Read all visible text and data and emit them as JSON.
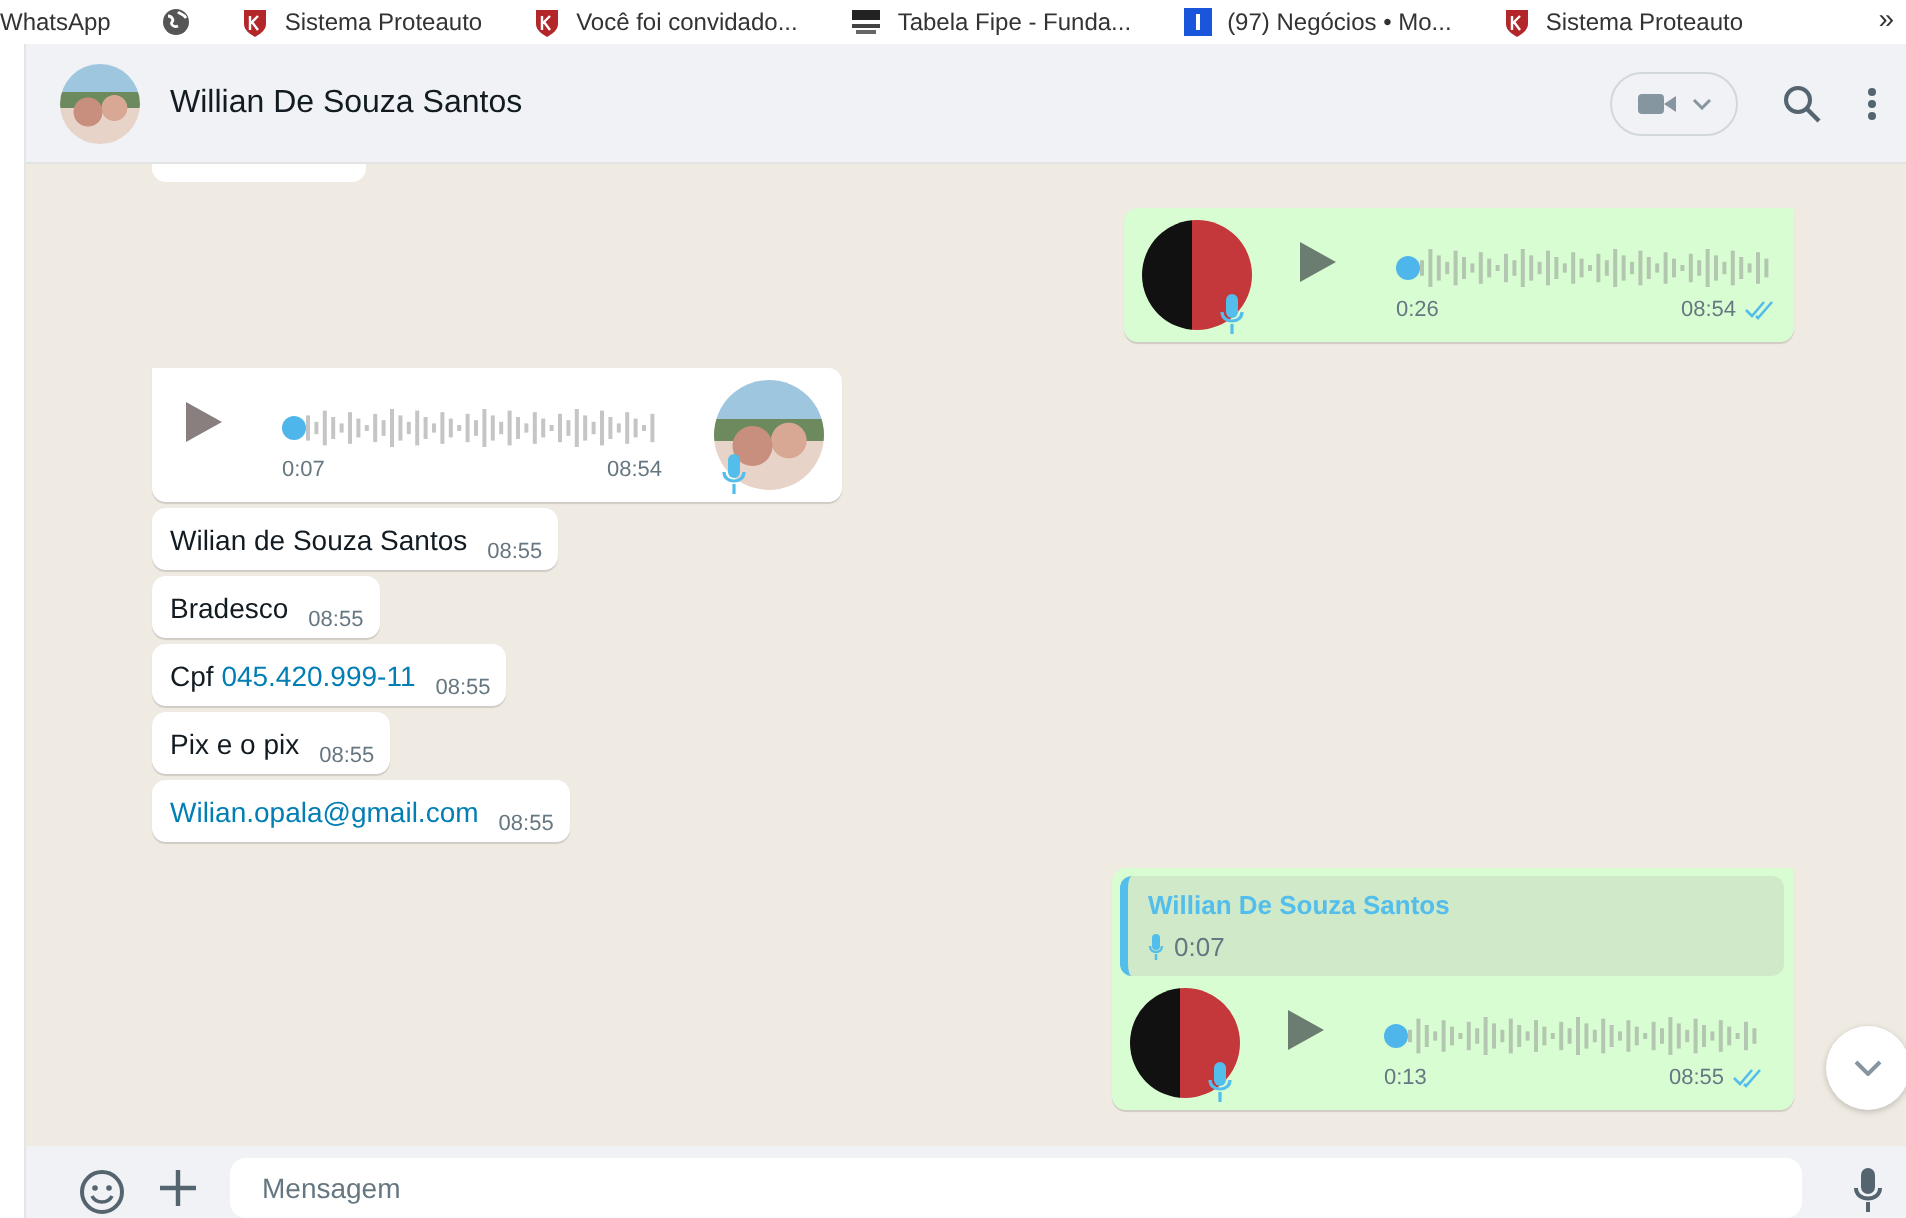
{
  "bookmarks": [
    {
      "kind": "text",
      "label": "WhatsApp"
    },
    {
      "kind": "globe"
    },
    {
      "kind": "shield",
      "label": "Sistema Proteauto"
    },
    {
      "kind": "shield",
      "label": "Você foi convidado..."
    },
    {
      "kind": "fipe",
      "label": "Tabela Fipe - Funda..."
    },
    {
      "kind": "square",
      "label": "(97) Negócios • Mo..."
    },
    {
      "kind": "shield",
      "label": "Sistema Proteauto"
    }
  ],
  "bookmarks_more": "»",
  "header": {
    "name": "Willian De Souza Santos"
  },
  "messages": [
    {
      "kind": "voice",
      "outgoing": true,
      "duration": "0:26",
      "time": "08:54",
      "read": true
    },
    {
      "kind": "voice",
      "outgoing": false,
      "duration": "0:07",
      "time": "08:54"
    },
    {
      "kind": "text",
      "outgoing": false,
      "text": "Wilian de Souza Santos",
      "time": "08:55"
    },
    {
      "kind": "text",
      "outgoing": false,
      "text": "Bradesco",
      "time": "08:55"
    },
    {
      "kind": "text",
      "outgoing": false,
      "text": "Cpf",
      "link": "045.420.999-11",
      "time": "08:55"
    },
    {
      "kind": "text",
      "outgoing": false,
      "text": "Pix e o pix",
      "time": "08:55"
    },
    {
      "kind": "text",
      "outgoing": false,
      "link": "Wilian.opala@gmail.com",
      "time": "08:55"
    },
    {
      "kind": "quoted_voice",
      "outgoing": true,
      "quote_name": "Willian De Souza Santos",
      "quote_duration": "0:07",
      "duration": "0:13",
      "time": "08:55",
      "read": true
    }
  ],
  "composer": {
    "placeholder": "Mensagem"
  }
}
